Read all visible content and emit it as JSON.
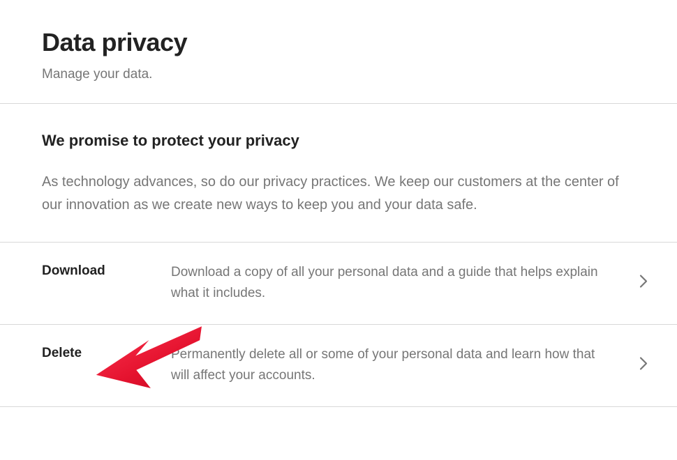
{
  "header": {
    "title": "Data privacy",
    "subtitle": "Manage your data."
  },
  "promise": {
    "title": "We promise to protect your privacy",
    "body": "As technology advances, so do our privacy practices. We keep our customers at the center of our innovation as we create new ways to keep you and your data safe."
  },
  "options": {
    "download": {
      "label": "Download",
      "description": "Download a copy of all your personal data and a guide that helps explain what it includes."
    },
    "delete": {
      "label": "Delete",
      "description": "Permanently delete all or some of your personal data and learn how that will affect your accounts."
    }
  },
  "annotation": {
    "arrow_color": "#e5132f"
  }
}
